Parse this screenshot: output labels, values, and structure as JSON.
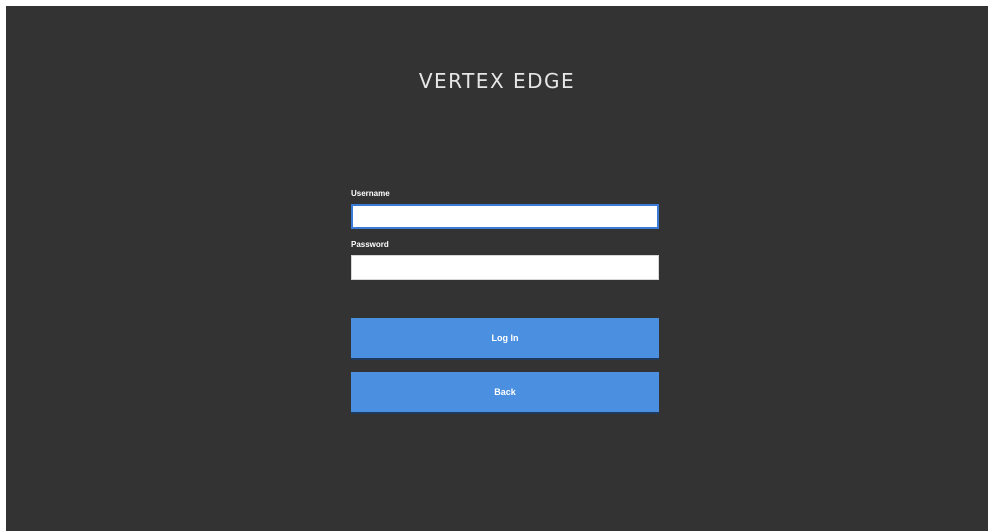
{
  "app": {
    "brand_title": "VERTEX EDGE"
  },
  "login_form": {
    "username_label": "Username",
    "username_value": "",
    "password_label": "Password",
    "password_value": "",
    "login_button_label": "Log In",
    "back_button_label": "Back"
  },
  "colors": {
    "background": "#333333",
    "button": "#4a8fe0",
    "focus_border": "#3a7bd5",
    "text": "#ffffff"
  }
}
